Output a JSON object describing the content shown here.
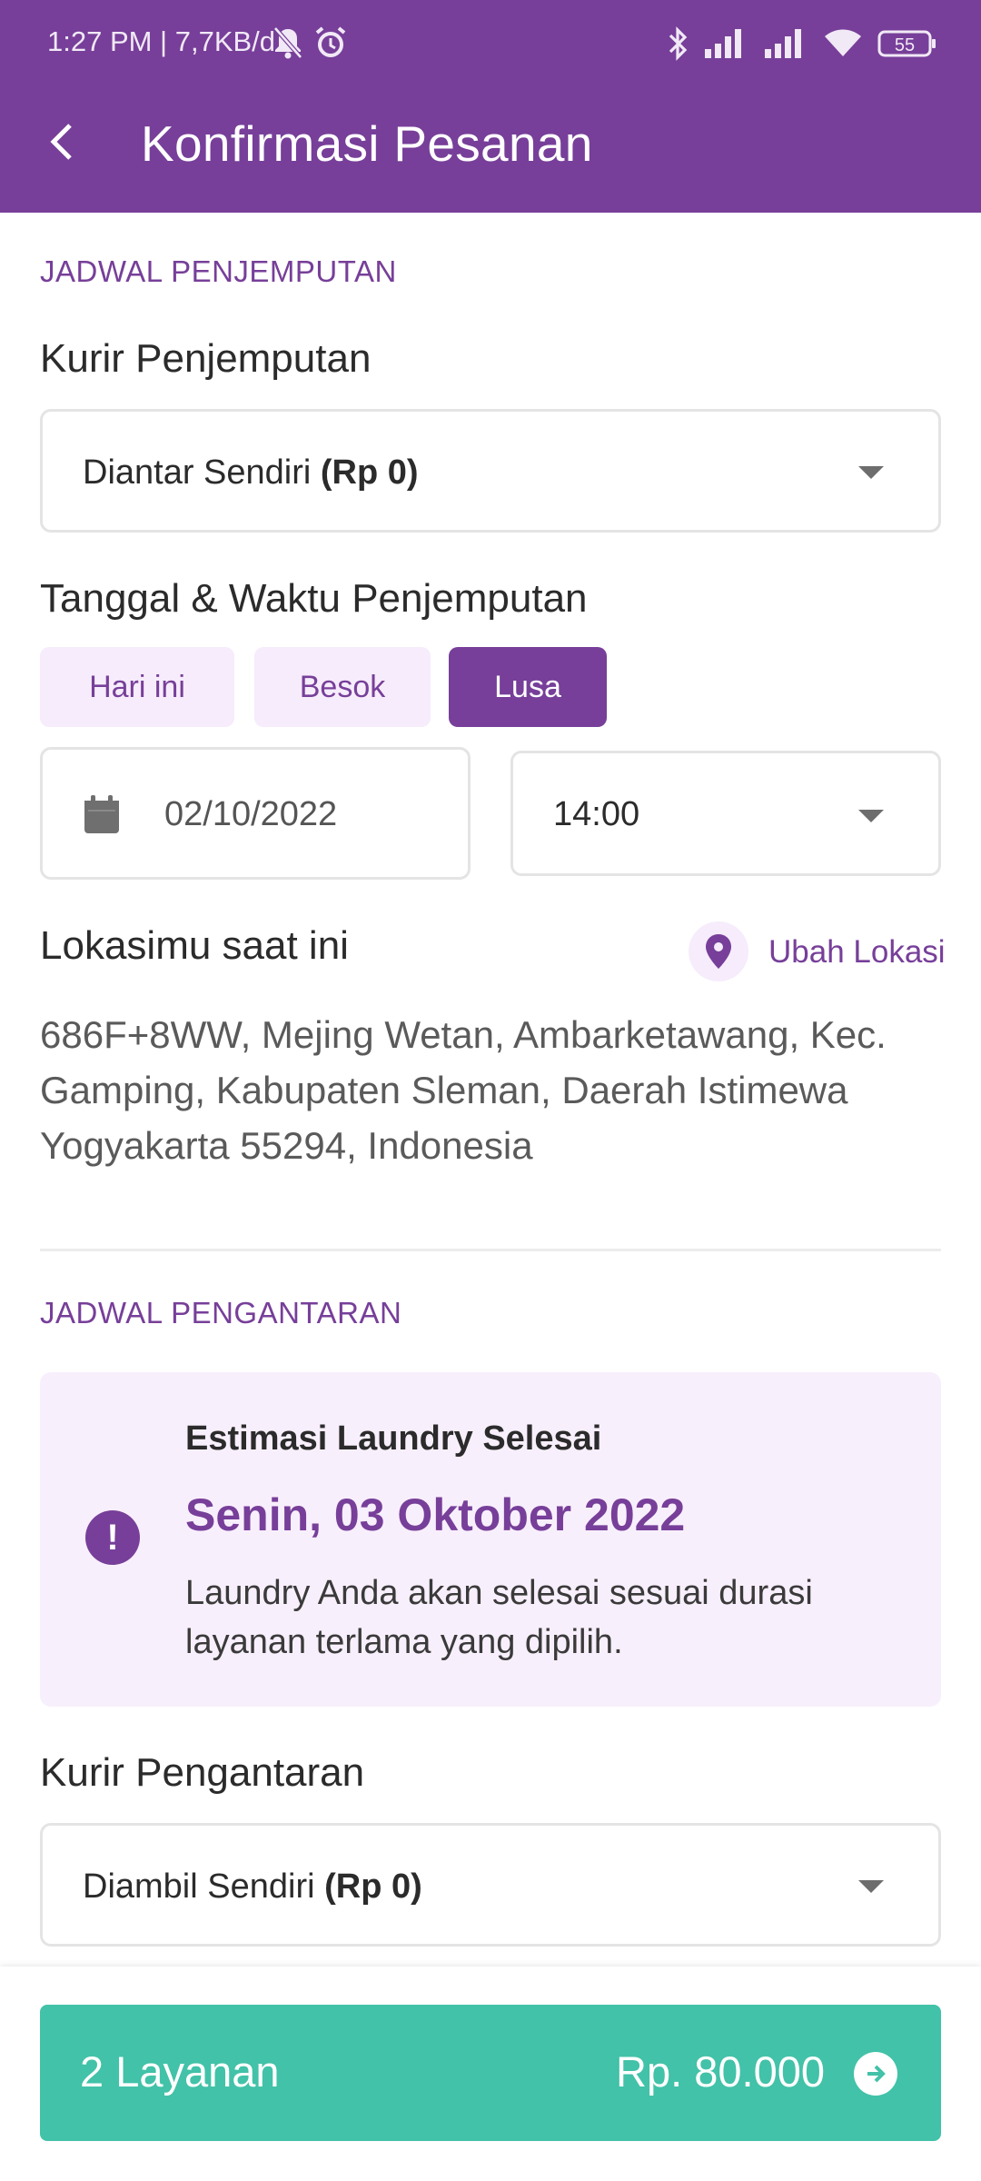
{
  "status_bar": {
    "time": "1:27 PM | 7,7KB/d",
    "battery": "55"
  },
  "header": {
    "title": "Konfirmasi Pesanan"
  },
  "pickup": {
    "section_label": "JADWAL PENJEMPUTAN",
    "courier_title": "Kurir Penjemputan",
    "courier_value": "Diantar Sendiri",
    "courier_price": "(Rp 0)",
    "datetime_title": "Tanggal & Waktu Penjemputan",
    "day_options": [
      "Hari ini",
      "Besok",
      "Lusa"
    ],
    "selected_day": "Lusa",
    "date": "02/10/2022",
    "time": "14:00",
    "location_title": "Lokasimu saat ini",
    "change_location": "Ubah Lokasi",
    "address": "686F+8WW, Mejing Wetan, Ambarketawang, Kec. Gamping, Kabupaten Sleman, Daerah Istimewa Yogyakarta 55294, Indonesia"
  },
  "delivery": {
    "section_label": "JADWAL PENGANTARAN",
    "estimate_title": "Estimasi Laundry Selesai",
    "estimate_date": "Senin, 03 Oktober 2022",
    "estimate_desc": "Laundry Anda akan selesai sesuai durasi layanan terlama yang dipilih.",
    "courier_title": "Kurir Pengantaran",
    "courier_value": "Diambil Sendiri",
    "courier_price": "(Rp 0)"
  },
  "checkout": {
    "services": "2 Layanan",
    "total": "Rp. 80.000"
  },
  "colors": {
    "primary": "#773f99",
    "accent": "#42c2a8",
    "chip_bg": "#f6ecfb"
  }
}
